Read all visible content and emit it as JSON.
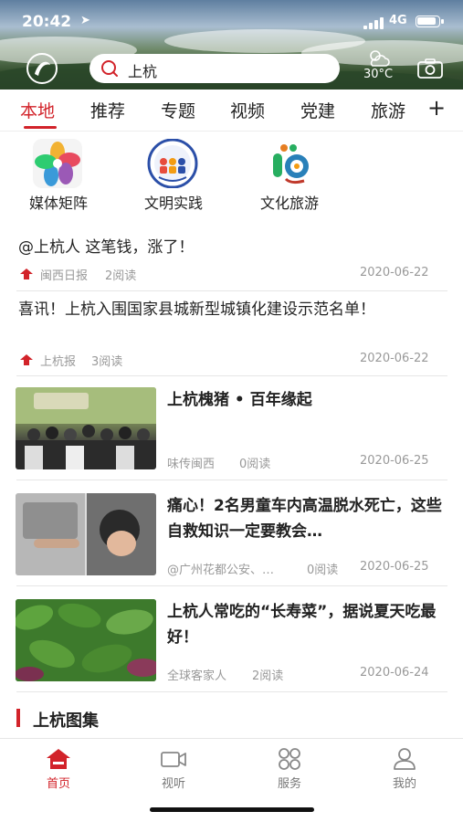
{
  "status_bar": {
    "time": "20:42",
    "network": "4G"
  },
  "header": {
    "search_text": "上杭",
    "weather_temp": "30°C",
    "logo_icon": "app-logo-icon",
    "search_icon": "search-icon",
    "camera_icon": "camera-icon",
    "weather_icon": "partly-cloudy-icon"
  },
  "tabs": [
    {
      "label": "本地",
      "active": true
    },
    {
      "label": "推荐"
    },
    {
      "label": "专题"
    },
    {
      "label": "视频"
    },
    {
      "label": "党建"
    },
    {
      "label": "旅游"
    }
  ],
  "tabs_more": "+",
  "shortcuts": [
    {
      "label": "媒体矩阵",
      "icon": "pinwheel-icon"
    },
    {
      "label": "文明实践",
      "icon": "civilization-badge-icon"
    },
    {
      "label": "文化旅游",
      "icon": "culture-tourism-icon"
    }
  ],
  "news": [
    {
      "title": "@上杭人 这笔钱，涨了！",
      "source": "闽西日报",
      "reads": "2阅读",
      "date": "2020-06-22",
      "hot": true
    },
    {
      "title": "喜讯！上杭入围国家县城新型城镇化建设示范名单！",
      "source": "上杭报",
      "reads": "3阅读",
      "date": "2020-06-22",
      "hot": true
    },
    {
      "title": "上杭槐猪 • 百年缘起",
      "source": "味传闽西",
      "reads": "0阅读",
      "date": "2020-06-25"
    },
    {
      "title": "痛心！2名男童车内高温脱水死亡，这些自救知识一定要教会…",
      "source": "@广州花都公安、…",
      "reads": "0阅读",
      "date": "2020-06-25"
    },
    {
      "title": "上杭人常吃的“长寿菜”，据说夏天吃最好！",
      "source": "全球客家人",
      "reads": "2阅读",
      "date": "2020-06-24"
    }
  ],
  "section_title": "上杭图集",
  "bottom_nav": [
    {
      "label": "首页",
      "icon": "home-icon",
      "active": true
    },
    {
      "label": "视听",
      "icon": "video-icon"
    },
    {
      "label": "服务",
      "icon": "grid-icon"
    },
    {
      "label": "我的",
      "icon": "user-icon"
    }
  ],
  "colors": {
    "accent": "#d2232a",
    "meta": "#999999"
  }
}
